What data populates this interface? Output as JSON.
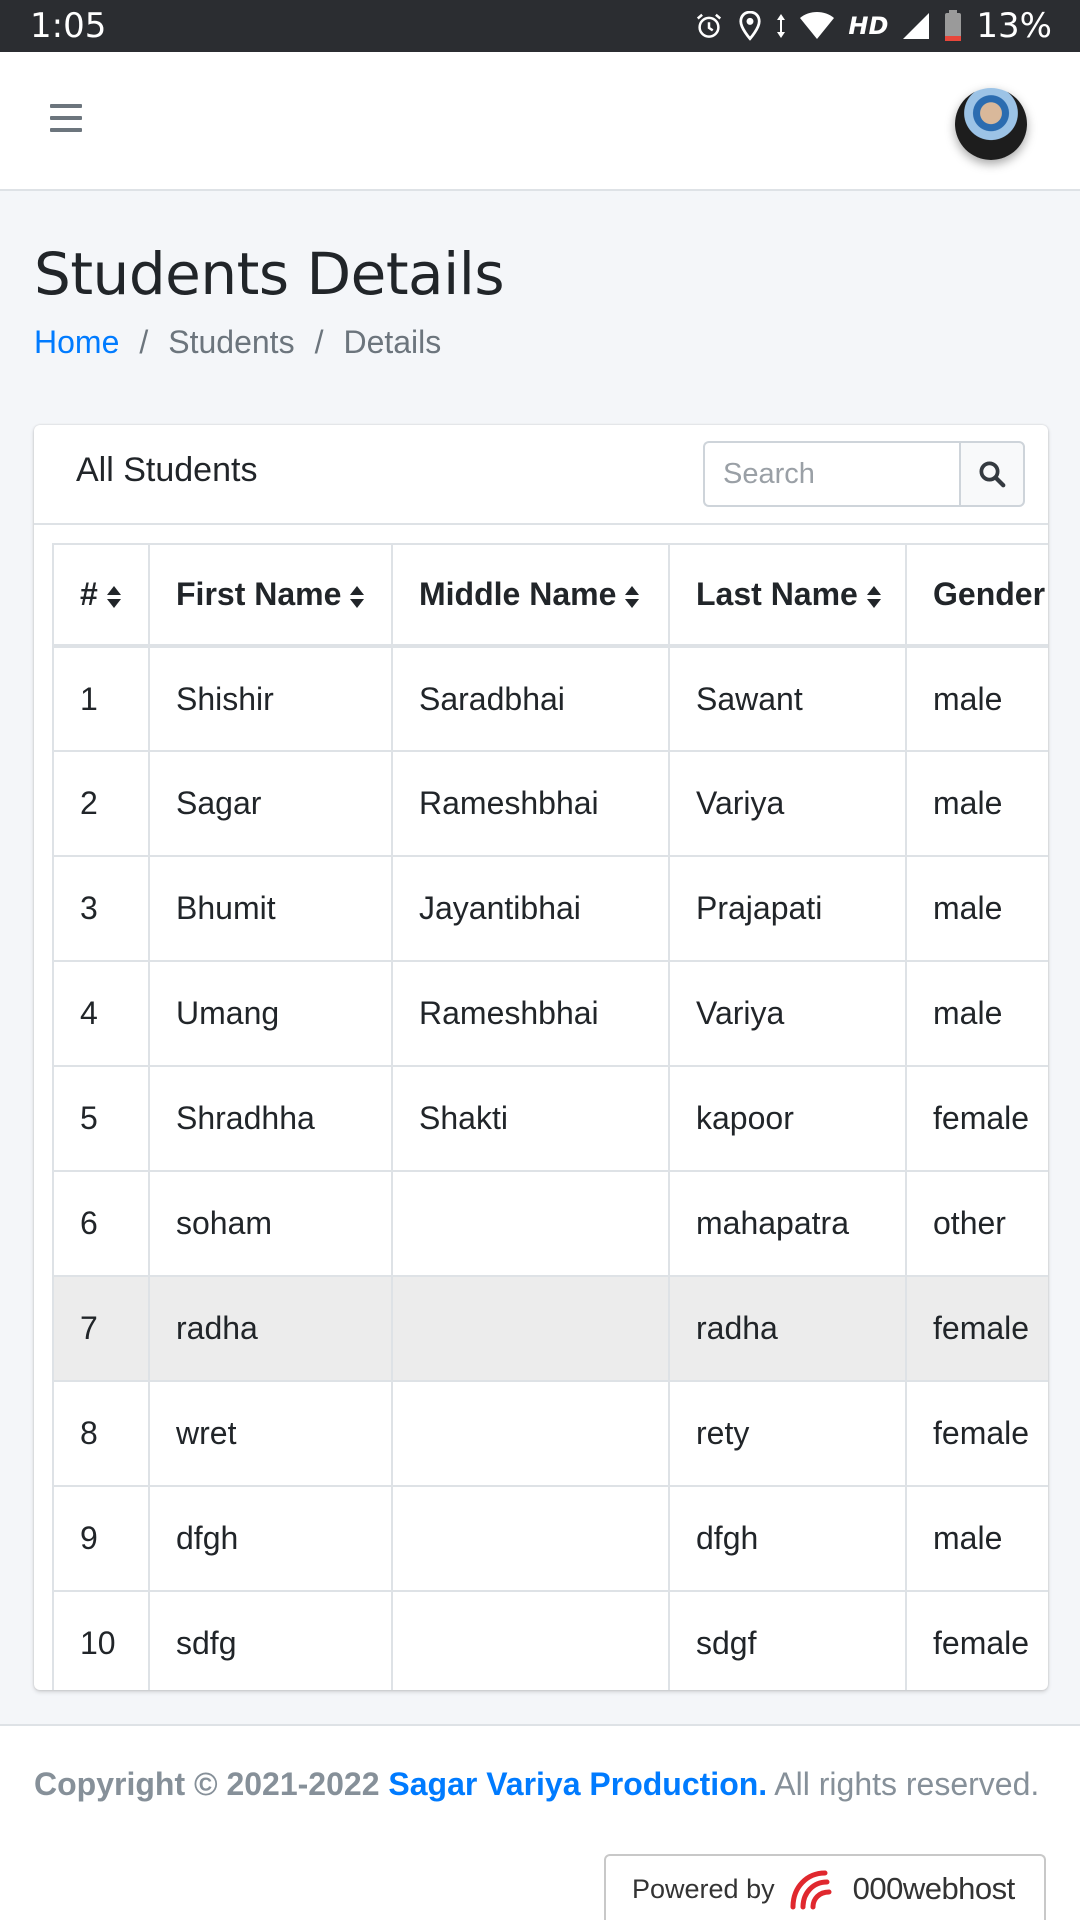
{
  "status_bar": {
    "time": "1:05",
    "icons": [
      "alarm-icon",
      "location-icon",
      "data-arrows-icon",
      "wifi-icon",
      "signal-icon",
      "battery-icon"
    ],
    "network_label": "HD",
    "battery_percent": "13%"
  },
  "navbar": {
    "menu_icon": "hamburger-icon",
    "avatar": "user-avatar"
  },
  "page": {
    "title": "Students Details",
    "breadcrumb": [
      {
        "label": "Home",
        "link": true
      },
      {
        "label": "Students",
        "link": false
      },
      {
        "label": "Details",
        "link": false
      }
    ],
    "separator": "/"
  },
  "card": {
    "title": "All Students",
    "search": {
      "placeholder": "Search",
      "value": "",
      "icon": "search-icon"
    }
  },
  "table": {
    "columns": [
      "#",
      "First Name",
      "Middle Name",
      "Last Name",
      "Gender"
    ],
    "sortable": [
      true,
      true,
      true,
      true,
      false
    ],
    "rows": [
      [
        "1",
        "Shishir",
        "Saradbhai",
        "Sawant",
        "male"
      ],
      [
        "2",
        "Sagar",
        "Rameshbhai",
        "Variya",
        "male"
      ],
      [
        "3",
        "Bhumit",
        "Jayantibhai",
        "Prajapati",
        "male"
      ],
      [
        "4",
        "Umang",
        "Rameshbhai",
        "Variya",
        "male"
      ],
      [
        "5",
        "Shradhha",
        "Shakti",
        "kapoor",
        "female"
      ],
      [
        "6",
        "soham",
        "",
        "mahapatra",
        "other"
      ],
      [
        "7",
        "radha",
        "",
        "radha",
        "female"
      ],
      [
        "8",
        "wret",
        "",
        "rety",
        "female"
      ],
      [
        "9",
        "dfgh",
        "",
        "dfgh",
        "male"
      ],
      [
        "10",
        "sdfg",
        "",
        "sdgf",
        "female"
      ]
    ],
    "highlighted_row": 7
  },
  "footer": {
    "copyright_prefix": "Copyright © 2021-2022",
    "brand": "Sagar Variya Production.",
    "suffix": "All rights reserved.",
    "powered_by": "Powered by",
    "host_name": "000webhost"
  },
  "colors": {
    "link": "#007bff",
    "page_bg": "#f4f6f9",
    "status_bar": "#2b2d31",
    "highlight_row": "#ececec"
  }
}
